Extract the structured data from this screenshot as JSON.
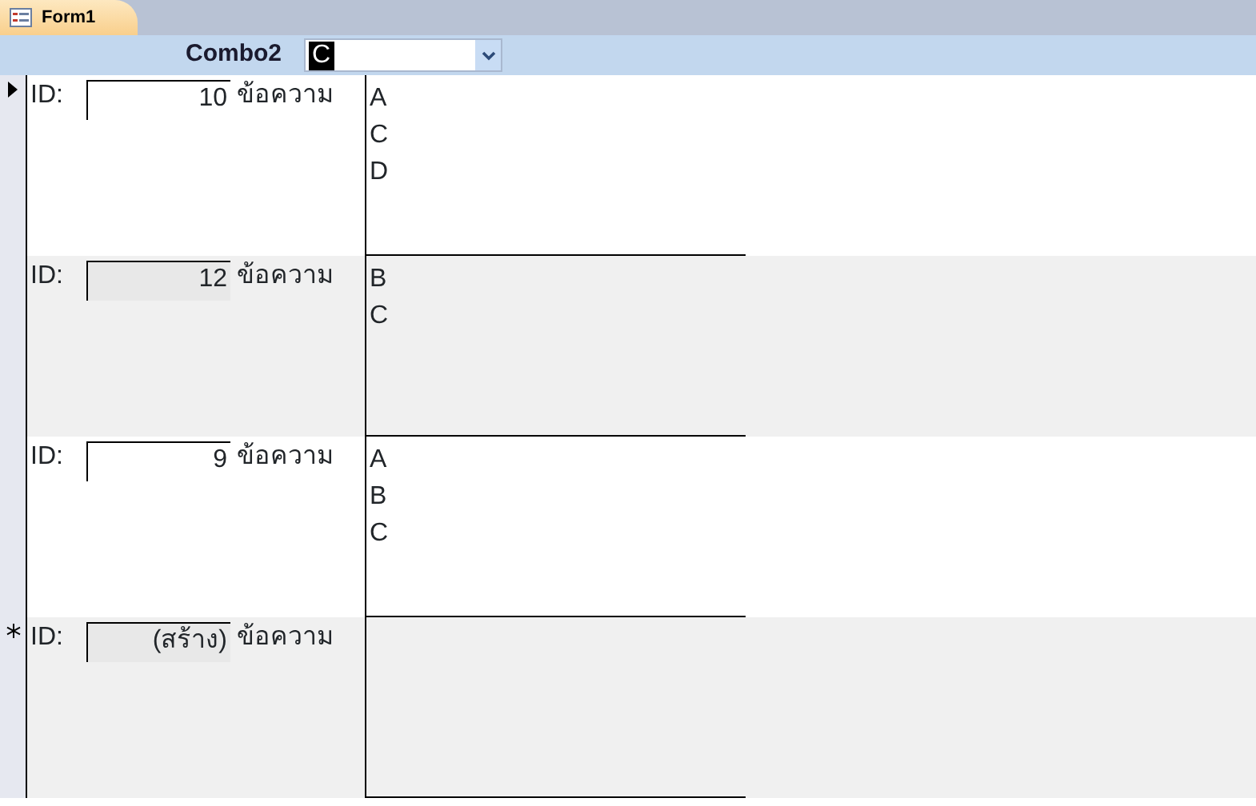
{
  "tab": {
    "title": "Form1",
    "selected": true
  },
  "header": {
    "combo_label": "Combo2",
    "combo_value": "C"
  },
  "records": [
    {
      "kind": "current",
      "id_label": "ID:",
      "id": "10",
      "text_label": "ข้อความ",
      "items": [
        "A",
        "C",
        "D"
      ]
    },
    {
      "kind": "plain",
      "id_label": "ID:",
      "id": "12",
      "text_label": "ข้อความ",
      "items": [
        "B",
        "C"
      ]
    },
    {
      "kind": "plain",
      "id_label": "ID:",
      "id": "9",
      "text_label": "ข้อความ",
      "items": [
        "A",
        "B",
        "C"
      ]
    },
    {
      "kind": "new",
      "id_label": "ID:",
      "id": "(สร้าง)",
      "text_label": "ข้อความ"
    }
  ]
}
